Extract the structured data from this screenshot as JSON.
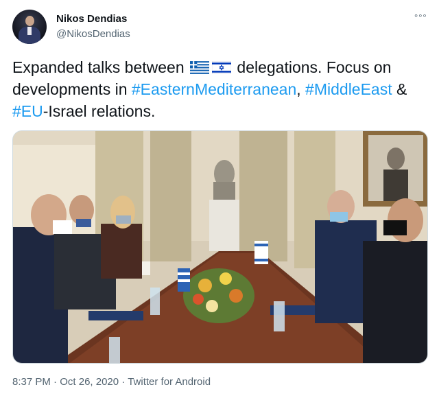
{
  "author": {
    "display_name": "Nikos Dendias",
    "handle": "@NikosDendias",
    "avatar_icon": "profile-photo"
  },
  "more_menu": "°°°",
  "tweet_text": {
    "part1": "Expanded talks between ",
    "flag1": "greece-flag-emoji",
    "flag2": "israel-flag-emoji",
    "part2": " delegations. Focus on developments in ",
    "hashtag1": "#EasternMediterranean",
    "sep1": ", ",
    "hashtag2": "#MiddleEast",
    "part3": " & ",
    "hashtag3": "#EU",
    "part4": "-Israel relations."
  },
  "media": {
    "kind": "photo",
    "description_icon": "meeting-photo"
  },
  "metadata": {
    "time": "8:37 PM",
    "separator": " · ",
    "date": "Oct 26, 2020",
    "source": "Twitter for Android"
  },
  "colors": {
    "link": "#1d9bf0",
    "text": "#0f1419",
    "secondary": "#536471"
  }
}
